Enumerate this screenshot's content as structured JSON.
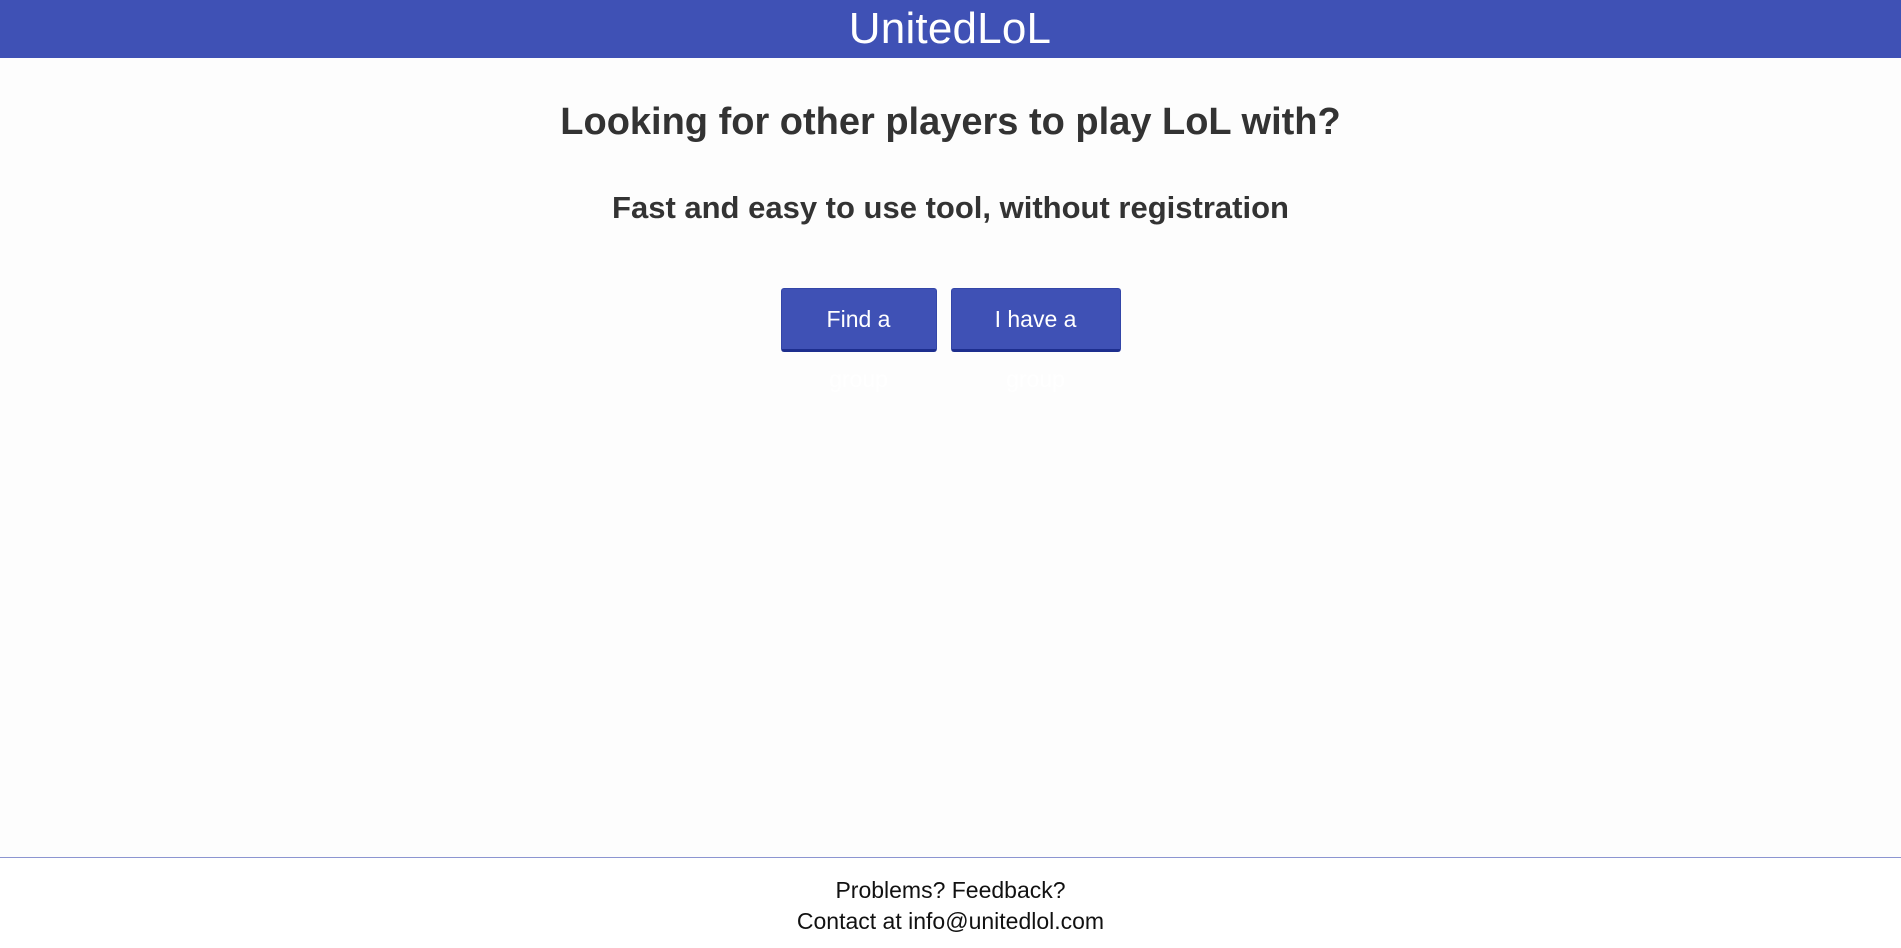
{
  "header": {
    "brand": "UnitedLoL"
  },
  "hero": {
    "headline": "Looking for other players to play LoL with?",
    "subline": "Fast and easy to use tool, without registration"
  },
  "actions": {
    "find_group": "Find a group",
    "have_group": "I have a group"
  },
  "footer": {
    "line1": "Problems? Feedback?",
    "line2": "Contact at info@unitedlol.com"
  },
  "colors": {
    "brand": "#3f51b5",
    "page_background": "#fdfdfd",
    "text": "#333333"
  }
}
